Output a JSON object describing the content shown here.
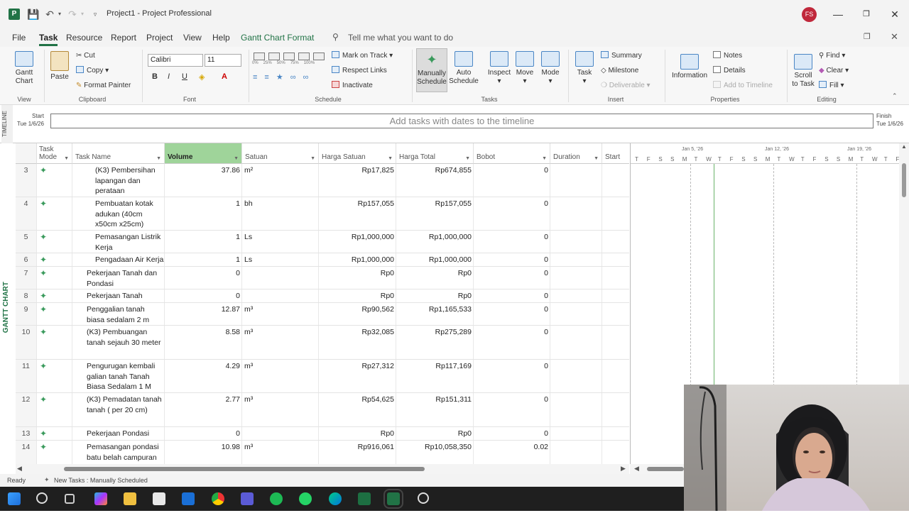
{
  "titlebar": {
    "title": "Project1 - Project Professional",
    "avatar": "FS"
  },
  "menu": [
    "File",
    "Task",
    "Resource",
    "Report",
    "Project",
    "View",
    "Help",
    "Gantt Chart Format"
  ],
  "tellme": "Tell me what you want to do",
  "ribbon": {
    "view": {
      "gantt": "Gantt\nChart",
      "label": "View"
    },
    "clipboard": {
      "paste": "Paste",
      "cut": "Cut",
      "copy": "Copy",
      "format_painter": "Format Painter",
      "label": "Clipboard"
    },
    "font": {
      "family": "Calibri",
      "size": "11",
      "label": "Font"
    },
    "schedule": {
      "mark": "Mark on Track",
      "respect": "Respect Links",
      "inactivate": "Inactivate",
      "label": "Schedule",
      "pcts": [
        "0%",
        "25%",
        "50%",
        "75%",
        "100%"
      ]
    },
    "tasks": {
      "manual": "Manually Schedule",
      "auto": "Auto Schedule",
      "inspect": "Inspect",
      "move": "Move",
      "mode": "Mode",
      "label": "Tasks"
    },
    "insert": {
      "task": "Task",
      "summary": "Summary",
      "milestone": "Milestone",
      "deliverable": "Deliverable",
      "label": "Insert"
    },
    "properties": {
      "information": "Information",
      "notes": "Notes",
      "details": "Details",
      "add_timeline": "Add to Timeline",
      "label": "Properties"
    },
    "editing": {
      "scroll": "Scroll to Task",
      "find": "Find",
      "clear": "Clear",
      "fill": "Fill",
      "label": "Editing"
    }
  },
  "timeline": {
    "side": "TIMELINE",
    "start_label": "Start",
    "start_date": "Tue 1/6/26",
    "placeholder": "Add tasks with dates to the timeline",
    "finish_label": "Finish",
    "finish_date": "Tue 1/6/26"
  },
  "gantt_side": "GANTT CHART",
  "columns": {
    "mode": "Task Mode",
    "name": "Task Name",
    "volume": "Volume",
    "satuan": "Satuan",
    "harga_satuan": "Harga Satuan",
    "harga_total": "Harga Total",
    "bobot": "Bobot",
    "duration": "Duration",
    "start": "Start"
  },
  "rows": [
    {
      "id": "3",
      "name": "(K3) Pembersihan lapangan dan perataan",
      "indent": 2,
      "volume": "37.86",
      "satuan": "m²",
      "hs": "Rp17,825",
      "ht": "Rp674,855",
      "bobot": "0"
    },
    {
      "id": "4",
      "name": "Pembuatan kotak adukan (40cm x50cm x25cm)",
      "indent": 2,
      "volume": "1",
      "satuan": "bh",
      "hs": "Rp157,055",
      "ht": "Rp157,055",
      "bobot": "0"
    },
    {
      "id": "5",
      "name": "Pemasangan Listrik Kerja",
      "indent": 2,
      "volume": "1",
      "satuan": "Ls",
      "hs": "Rp1,000,000",
      "ht": "Rp1,000,000",
      "bobot": "0"
    },
    {
      "id": "6",
      "name": "Pengadaan Air Kerja",
      "indent": 2,
      "volume": "1",
      "satuan": "Ls",
      "hs": "Rp1,000,000",
      "ht": "Rp1,000,000",
      "bobot": "0"
    },
    {
      "id": "7",
      "name": "Pekerjaan Tanah dan Pondasi",
      "indent": 1,
      "volume": "0",
      "satuan": "",
      "hs": "Rp0",
      "ht": "Rp0",
      "bobot": "0"
    },
    {
      "id": "8",
      "name": "Pekerjaan Tanah",
      "indent": 1,
      "volume": "0",
      "satuan": "",
      "hs": "Rp0",
      "ht": "Rp0",
      "bobot": "0"
    },
    {
      "id": "9",
      "name": "Penggalian tanah biasa sedalam 2 m",
      "indent": 1,
      "volume": "12.87",
      "satuan": "m³",
      "hs": "Rp90,562",
      "ht": "Rp1,165,533",
      "bobot": "0"
    },
    {
      "id": "10",
      "name": "(K3) Pembuangan tanah sejauh 30 meter",
      "indent": 1,
      "volume": "8.58",
      "satuan": "m³",
      "hs": "Rp32,085",
      "ht": "Rp275,289",
      "bobot": "0"
    },
    {
      "id": "11",
      "name": "Pengurugan kembali galian tanah Tanah Biasa Sedalam 1 M",
      "indent": 1,
      "volume": "4.29",
      "satuan": "m³",
      "hs": "Rp27,312",
      "ht": "Rp117,169",
      "bobot": "0"
    },
    {
      "id": "12",
      "name": "(K3) Pemadatan tanah tanah ( per 20 cm)",
      "indent": 1,
      "volume": "2.77",
      "satuan": "m³",
      "hs": "Rp54,625",
      "ht": "Rp151,311",
      "bobot": "0"
    },
    {
      "id": "13",
      "name": "Pekerjaan Pondasi",
      "indent": 1,
      "volume": "0",
      "satuan": "",
      "hs": "Rp0",
      "ht": "Rp0",
      "bobot": "0"
    },
    {
      "id": "14",
      "name": "Pemasangan pondasi batu belah campuran",
      "indent": 1,
      "volume": "10.98",
      "satuan": "m³",
      "hs": "Rp916,061",
      "ht": "Rp10,058,350",
      "bobot": "0.02"
    }
  ],
  "gantt": {
    "weeks": [
      "Jan 5, '26",
      "Jan 12, '26",
      "Jan 19, '26"
    ],
    "days": [
      "T",
      "F",
      "S",
      "S",
      "M",
      "T",
      "W",
      "T",
      "F",
      "S",
      "S",
      "M",
      "T",
      "W",
      "T",
      "F",
      "S",
      "S",
      "M",
      "T",
      "W",
      "T",
      "F"
    ]
  },
  "status": {
    "ready": "Ready",
    "new_tasks": "New Tasks : Manually Scheduled"
  },
  "colors": {
    "accent": "#217346",
    "volume_header": "#9fd49a"
  }
}
